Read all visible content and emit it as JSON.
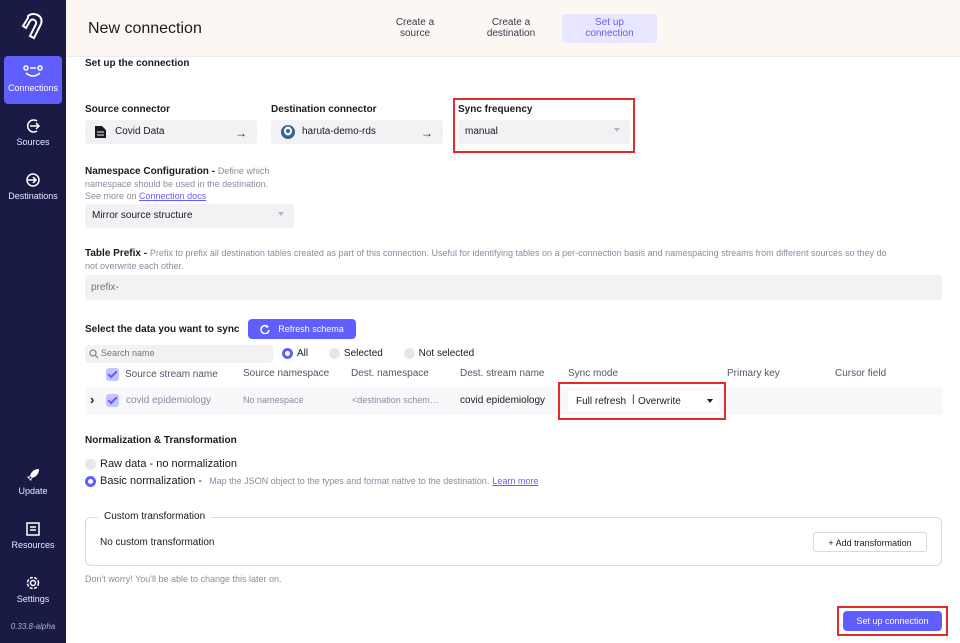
{
  "sidebar": {
    "items": [
      {
        "label": "Connections",
        "icon": "connections-icon",
        "active": true
      },
      {
        "label": "Sources",
        "icon": "sources-icon"
      },
      {
        "label": "Destinations",
        "icon": "destinations-icon"
      },
      {
        "label": "Update",
        "icon": "rocket-icon"
      },
      {
        "label": "Resources",
        "icon": "book-icon"
      },
      {
        "label": "Settings",
        "icon": "gear-icon"
      }
    ],
    "version": "0.33.8-alpha"
  },
  "header": {
    "title": "New connection",
    "steps": [
      {
        "line1": "Create a",
        "line2": "source"
      },
      {
        "line1": "Create a",
        "line2": "destination"
      },
      {
        "line1": "Set up",
        "line2": "connection"
      }
    ]
  },
  "setup": {
    "title": "Set up the connection",
    "source_label": "Source connector",
    "source_value": "Covid Data",
    "dest_label": "Destination connector",
    "dest_value": "haruta-demo-rds",
    "freq_label": "Sync frequency",
    "freq_value": "manual",
    "namespace_label": "Namespace Configuration -",
    "namespace_hint": "Define which",
    "namespace_hint2": "namespace should be used in the destination.",
    "namespace_seemore": "See more on",
    "namespace_link": "Connection docs",
    "namespace_value": "Mirror source structure",
    "prefix_label": "Table Prefix -",
    "prefix_hint": "Prefix to prefix all destination tables created as part of this connection. Useful for identifying tables on a per-connection basis and namespacing streams from different sources so they do",
    "prefix_hint2": "not overwrite each other.",
    "prefix_placeholder": "prefix-"
  },
  "streams": {
    "title": "Select the data you want to sync",
    "refresh_label": "Refresh schema",
    "search_placeholder": "Search name",
    "filters": [
      "All",
      "Selected",
      "Not selected"
    ],
    "columns": [
      "Source stream name",
      "Source namespace",
      "Dest. namespace",
      "Dest. stream name",
      "Sync mode",
      "Primary key",
      "Cursor field"
    ],
    "rows": [
      {
        "source": "covid epidemiology",
        "namespace": "No namespace",
        "dest_namespace": "<destination schem…",
        "dest_stream": "covid epidemiology",
        "sync_mode_a": "Full refresh",
        "sync_mode_b": "Overwrite"
      }
    ]
  },
  "normalization": {
    "title": "Normalization & Transformation",
    "raw_label": "Raw data - no normalization",
    "basic_label": "Basic normalization -",
    "basic_hint": "Map the JSON object to the types and format native to the destination.",
    "learn_more": "Learn more",
    "custom_legend": "Custom transformation",
    "custom_empty": "No custom transformation",
    "add_transform": "+ Add transformation",
    "footer_note": "Don't worry! You'll be able to change this later on."
  },
  "submit_label": "Set up connection",
  "colors": {
    "accent": "#615eff",
    "sidebar": "#1a1b45",
    "highlight": "#e02b2b"
  }
}
